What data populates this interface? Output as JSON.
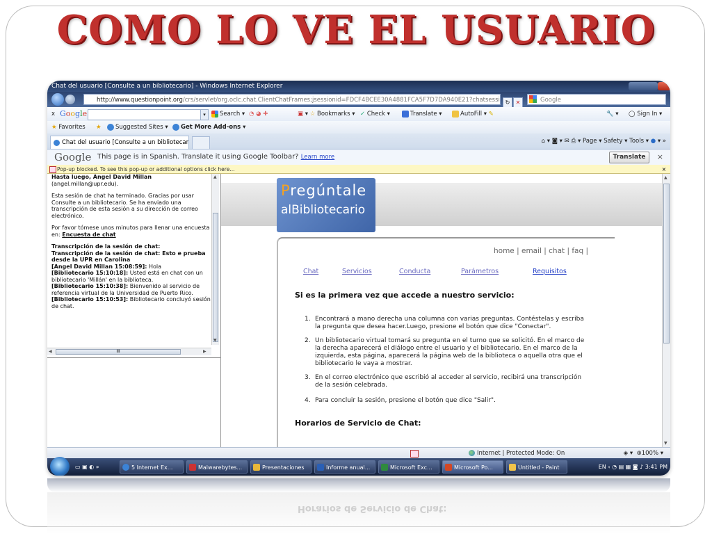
{
  "slide": {
    "title": "COMO LO VE EL USUARIO"
  },
  "window": {
    "title": "Chat del usuario [Consulte a un bibliotecario] - Windows Internet Explorer"
  },
  "address": {
    "url_bold": "http://www.questionpoint.org",
    "url_rest": "/crs/servlet/org.oclc.chat.ClientChatFrames;jsessionid=FDCF4BCEE30A4881FCA5F7D7DA940E21?chatsessionid=FDCI",
    "search_placeholder": "Google"
  },
  "google_toolbar": {
    "close": "x",
    "logo": "Google",
    "search": "Search",
    "bookmarks": "Bookmarks",
    "check": "Check",
    "translate": "Translate",
    "autofill": "AutoFill",
    "signin": "Sign In"
  },
  "favorites_bar": {
    "favorites": "Favorites",
    "suggested": "Suggested Sites",
    "addons": "Get More Add-ons"
  },
  "tab": {
    "label": "Chat del usuario [Consulte a un bibliotecario]",
    "page": "Page",
    "safety": "Safety",
    "tools": "Tools"
  },
  "translate_bar": {
    "logo": "Google",
    "message": "This page is in Spanish.  Translate it using Google Toolbar?",
    "learn_more": "Learn more",
    "button": "Translate",
    "close": "×"
  },
  "popup_bar": {
    "message": "Pop-up blocked. To see this pop-up or additional options click here...",
    "close": "×"
  },
  "chat": {
    "p1_bold": "Hasta luego, Angel David Millan",
    "p1_rest": "(angel.millan@upr.edu).",
    "p2": "Esta sesión de chat ha terminado. Gracias por usar Consulte a un bibliotecario. Se ha enviado una transcripción de esta sesión a su dirección de correo electrónico.",
    "p3": "Por favor tómese unos minutos para llenar una encuesta en:",
    "p3_link": "Encuesta de chat",
    "t_head": "Transcripción de la sesión de chat:",
    "t_sub": "Transcripción de la sesión de chat: Esto e prueba desde la UPR en Carolina",
    "m1_who": "[Angel David Millan 15:08:59]:",
    "m1_text": "Hola",
    "m2_who": "[Bibliotecario 15:10:18]:",
    "m2_text": "Usted está en chat con un bibliotecario 'Millán' en la biblioteca.",
    "m3_who": "[Bibliotecario 15:10:38]:",
    "m3_text": "Bienvenido al servicio de referencia virtual de la Universidad de Puerto Rico.",
    "m4_who": "[Bibliotecario 15:10:53]:",
    "m4_text": "Bibliotecario concluyó sesión de chat.",
    "hscroll_grip": "III"
  },
  "site": {
    "logo_line1": "regúntale",
    "logo_q": "P",
    "logo_line2": "alBibliotecario",
    "top_links": "home | email | chat | faq |",
    "nav": [
      "Chat",
      "Servicios",
      "Conducta",
      "Parámetros",
      "Requisitos"
    ],
    "heading1": "Si es la primera vez que accede a nuestro servicio:",
    "steps": [
      "Encontrará a mano derecha una columna con varias preguntas. Contéstelas y escriba la pregunta que desea hacer.Luego, presione el botón que dice \"Conectar\".",
      "Un bibliotecario virtual tomará su pregunta en el turno que se solicitó. En el marco de la derecha aparecerá el diálogo entre el usuario y el bibliotecario. En el marco de la izquierda, esta página, aparecerá la página web de la biblioteca o aquella otra que el bibliotecario le vaya a mostrar.",
      "En el correo electrónico que escribió al acceder al servicio, recibirá una transcripción de la sesión celebrada.",
      "Para concluir la sesión, presione el botón que dice \"Salir\"."
    ],
    "step_numbers": [
      "1.",
      "2.",
      "3.",
      "4."
    ],
    "heading2": "Horarios de Servicio de Chat:"
  },
  "status": {
    "zone": "Internet | Protected Mode: On",
    "zoom": "100%"
  },
  "taskbar": {
    "items": [
      "5 Internet Ex...",
      "Malwarebytes...",
      "Presentaciones",
      "Informe anual...",
      "Microsoft Exc...",
      "Microsoft Po...",
      "Untitled - Paint"
    ],
    "lang": "EN",
    "time": "3:41 PM"
  }
}
